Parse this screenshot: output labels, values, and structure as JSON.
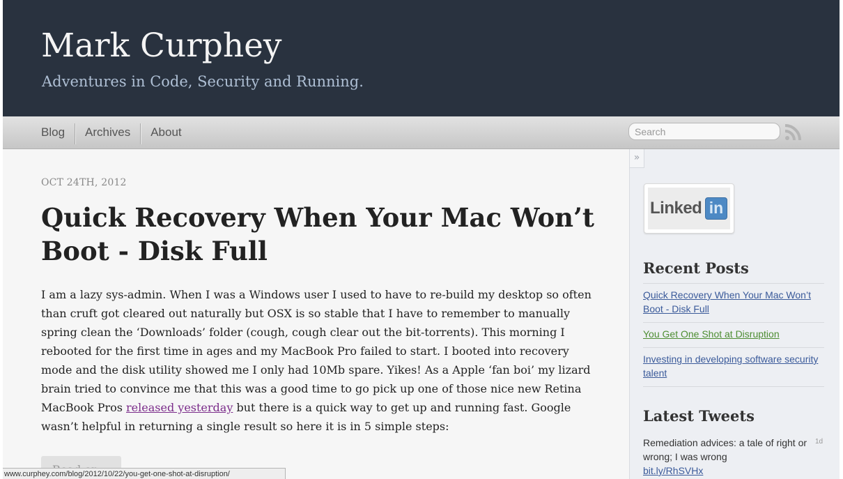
{
  "header": {
    "title": "Mark Curphey",
    "subtitle": "Adventures in Code, Security and Running."
  },
  "nav": {
    "items": [
      {
        "label": "Blog"
      },
      {
        "label": "Archives"
      },
      {
        "label": "About"
      }
    ],
    "search_placeholder": "Search",
    "rss_icon": "rss-icon"
  },
  "post": {
    "date": "OCT 24TH, 2012",
    "title": "Quick Recovery When Your Mac Won’t Boot - Disk Full",
    "body_before_link": "I am a lazy sys-admin. When I was a Windows user I used to have to re-build my desktop so often than cruft got cleared out naturally but OSX is so stable that I have to remember to manually spring clean the ‘Downloads’ folder (cough, cough clear out the bit-torrents). This morning I rebooted for the first time in ages and my MacBook Pro failed to start. I booted into recovery mode and the disk utility showed me I only had 10Mb spare. Yikes! As a Apple ‘fan boi’ my lizard brain tried to convince me that this was a good time to go pick up one of those nice new Retina MacBook Pros ",
    "link_text": "released yesterday",
    "body_after_link": " but there is a quick way to get up and running fast. Google wasn’t helpful in returning a single result so here it is in 5 simple steps:",
    "read_on_label": "Read on"
  },
  "status_bar": {
    "url": "www.curphey.com/blog/2012/10/22/you-get-one-shot-at-disruption/"
  },
  "sidebar": {
    "collapse_glyph": "»",
    "linkedin": {
      "text": "Linked",
      "box": "in"
    },
    "recent_heading": "Recent Posts",
    "recent_posts": [
      {
        "title": "Quick Recovery When Your Mac Won’t Boot - Disk Full"
      },
      {
        "title": "You Get One Shot at Disruption"
      },
      {
        "title": "Investing in developing software security talent"
      }
    ],
    "tweets_heading": "Latest Tweets",
    "tweet": {
      "text": "Remediation advices: a tale of right or wrong; I was wrong",
      "link": "bit.ly/RhSVHx",
      "time": "1d"
    }
  },
  "colors": {
    "header_bg": "#29323f",
    "subtitle": "#aebfd4",
    "link_visited": "#7b2c8a",
    "sidebar_link": "#3a5a9a",
    "sidebar_link_visited": "#4d8d32"
  }
}
